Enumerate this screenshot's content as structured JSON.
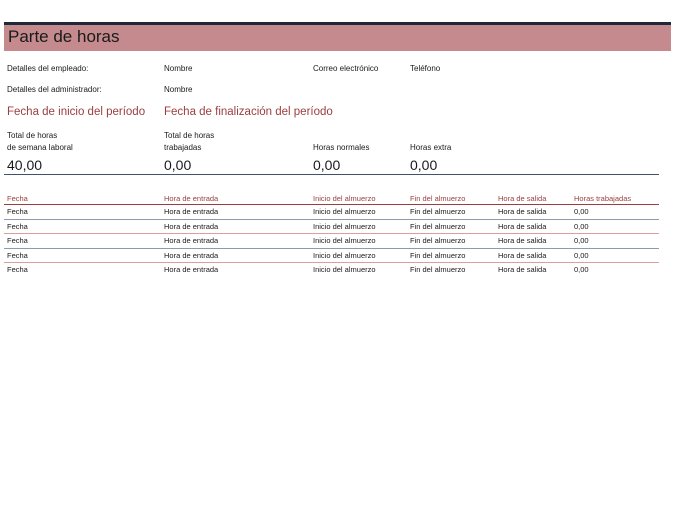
{
  "title": "Parte de horas",
  "labels": {
    "employee_details": "Detalles del empleado:",
    "admin_details": "Detalles del administrador:",
    "name": "Nombre",
    "email": "Correo electrónico",
    "phone": "Teléfono",
    "admin_name": "Nombre",
    "period_start": "Fecha de inicio del período",
    "period_end": "Fecha de finalización del período"
  },
  "summary": {
    "workweek_label_1": "Total de horas",
    "workweek_label_2": "de semana laboral",
    "worked_label_1": "Total de horas",
    "worked_label_2": "trabajadas",
    "regular_label": "Horas normales",
    "overtime_label": "Horas extra",
    "workweek_value": "40,00",
    "worked_value": "0,00",
    "regular_value": "0,00",
    "overtime_value": "0,00"
  },
  "table": {
    "columns": [
      "Fecha",
      "Hora de entrada",
      "Inicio del almuerzo",
      "Fin del almuerzo",
      "Hora de salida",
      "Horas trabajadas"
    ],
    "rows": [
      [
        "Fecha",
        "Hora de entrada",
        "Inicio del almuerzo",
        "Fin del almuerzo",
        "Hora de salida",
        "0,00"
      ],
      [
        "Fecha",
        "Hora de entrada",
        "Inicio del almuerzo",
        "Fin del almuerzo",
        "Hora de salida",
        "0,00"
      ],
      [
        "Fecha",
        "Hora de entrada",
        "Inicio del almuerzo",
        "Fin del almuerzo",
        "Hora de salida",
        "0,00"
      ],
      [
        "Fecha",
        "Hora de entrada",
        "Inicio del almuerzo",
        "Fin del almuerzo",
        "Hora de salida",
        "0,00"
      ],
      [
        "Fecha",
        "Hora de entrada",
        "Inicio del almuerzo",
        "Fin del almuerzo",
        "Hora de salida",
        "0,00"
      ]
    ]
  },
  "colors": {
    "title_bar": "#c48a8d",
    "accent": "#9c3d3d",
    "dark_rule": "#1e2838"
  }
}
